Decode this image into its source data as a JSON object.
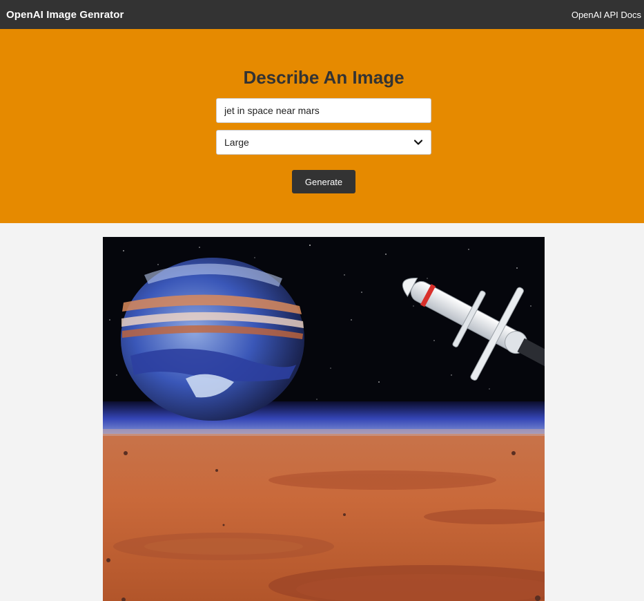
{
  "navbar": {
    "logo": "OpenAI Image Genrator",
    "link": "OpenAI API Docs"
  },
  "form": {
    "title": "Describe An Image",
    "prompt_value": "jet in space near mars",
    "size_value": "Large",
    "generate_label": "Generate"
  },
  "colors": {
    "navbar_bg": "#333333",
    "showcase_bg": "#e68a00",
    "page_bg": "#f3f3f3",
    "button_bg": "#333333"
  },
  "result": {
    "icon": "generated-image"
  }
}
